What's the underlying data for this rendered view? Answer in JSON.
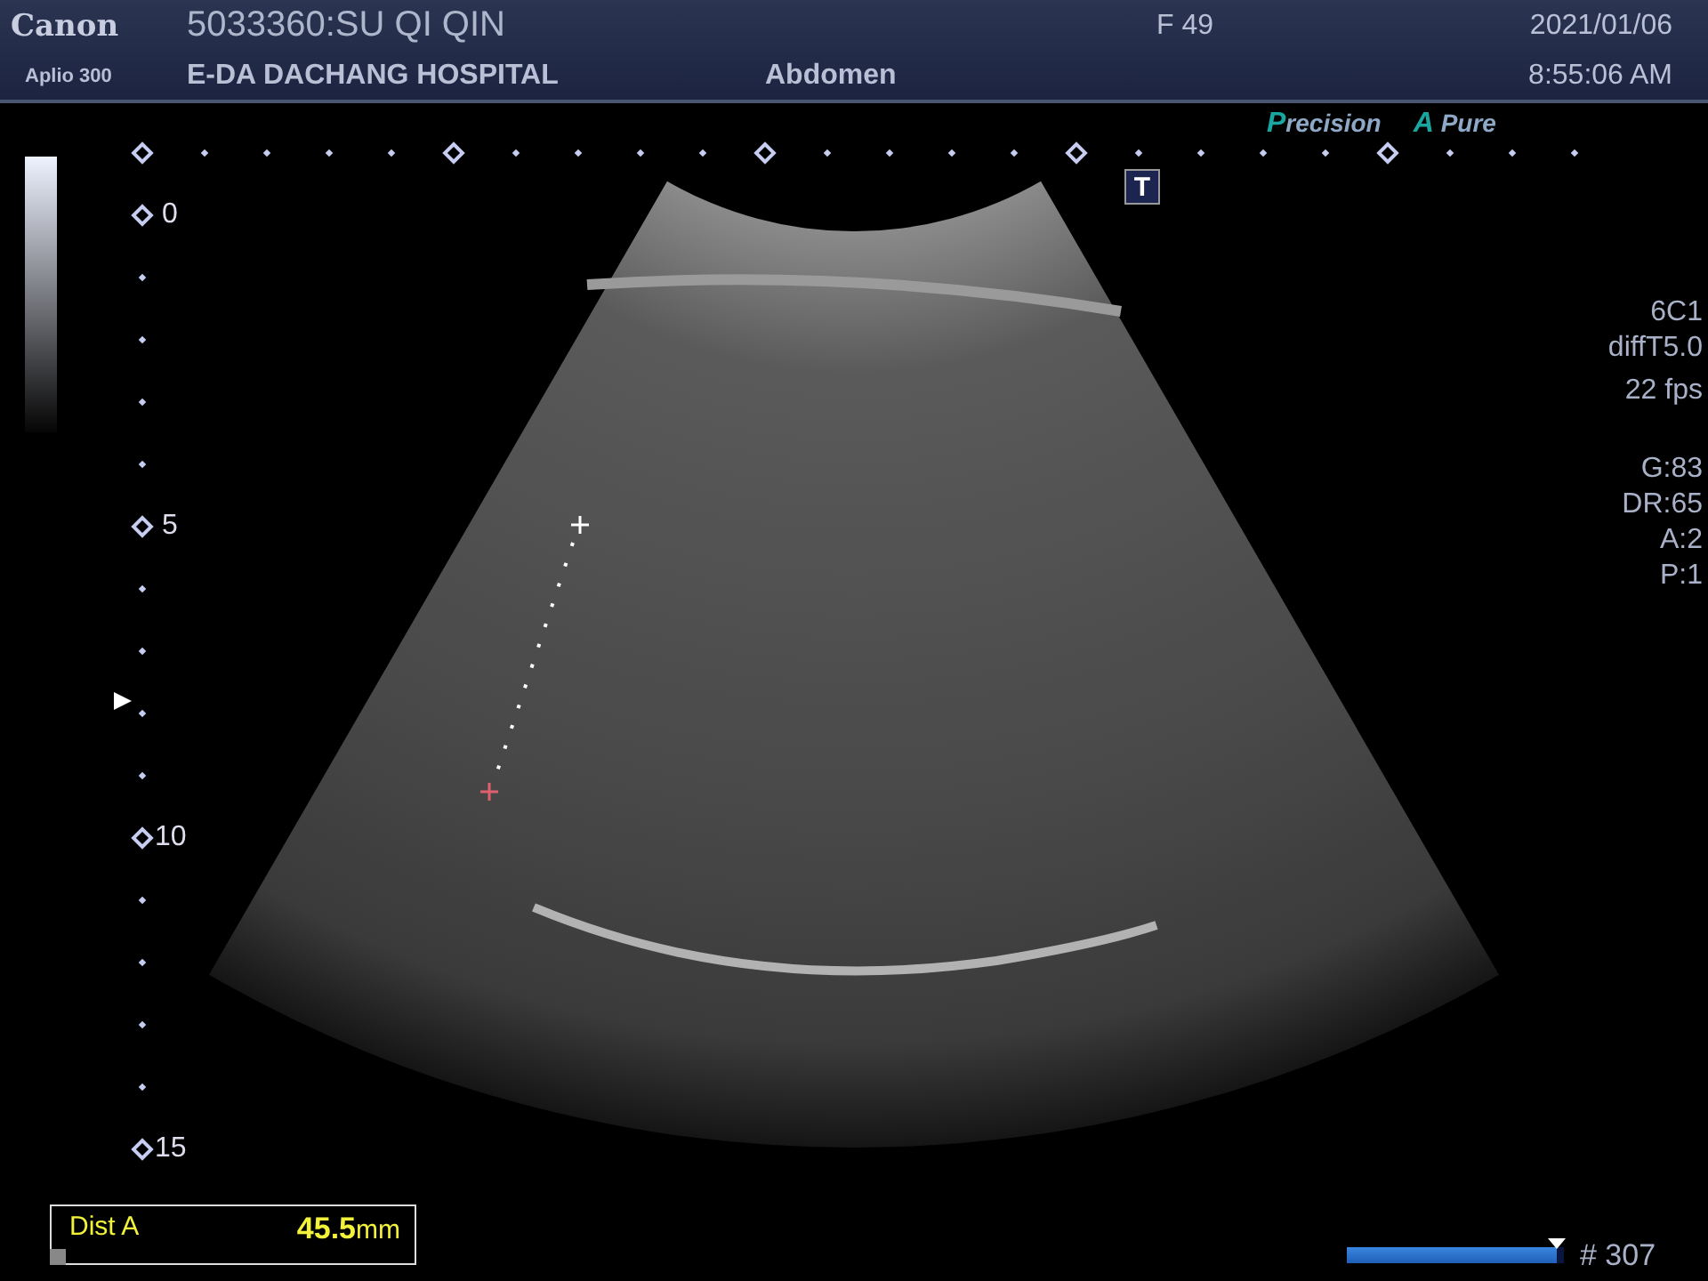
{
  "header": {
    "brand": "Canon",
    "model": "Aplio 300",
    "patient": "5033360:SU QI QIN",
    "sex_age": "F  49",
    "hospital": "E-DA DACHANG HOSPITAL",
    "exam": "Abdomen",
    "date": "2021/01/06",
    "time": "8:55:06 AM"
  },
  "modes": [
    "Precision",
    "A Pure"
  ],
  "t_marker": "T",
  "depth_scale": {
    "labels": [
      "0",
      "5",
      "10",
      "15"
    ]
  },
  "probe_info": [
    "6C1",
    "diffT5.0",
    "22 fps"
  ],
  "params": [
    "G:83",
    "DR:65",
    "A:2",
    "P:1"
  ],
  "measurement": {
    "label": "Dist A",
    "value": "45.5",
    "unit": "mm"
  },
  "cine": {
    "level": 0.97,
    "frame": "# 307"
  }
}
